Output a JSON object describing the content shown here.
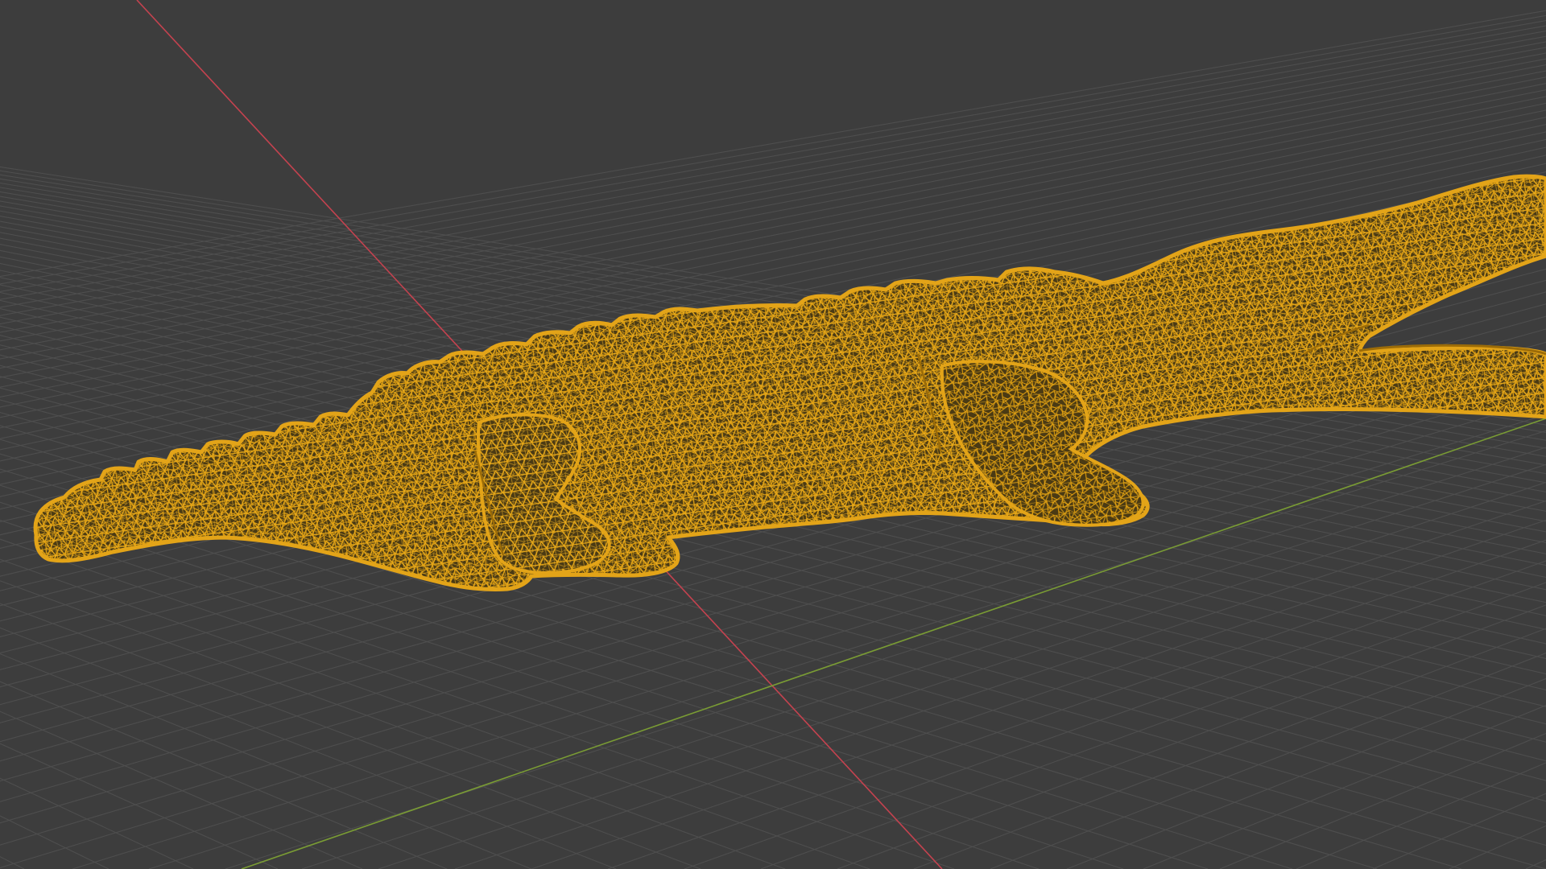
{
  "viewport": {
    "mode": "wireframe",
    "shading": "wireframe",
    "object": "crocodile-mesh",
    "selected": true,
    "show_floor_grid": true,
    "show_x_axis": true,
    "show_y_axis": true
  },
  "colors": {
    "background": "#3d3d3d",
    "grid_line": "#4e4e4e",
    "grid_line_major": "#585858",
    "x_axis": "#c4424f",
    "y_axis": "#7a9c34",
    "wire": "#e3a418",
    "wire_dark": "#9c6c08",
    "wire_shadow": "#2b2b2b"
  }
}
